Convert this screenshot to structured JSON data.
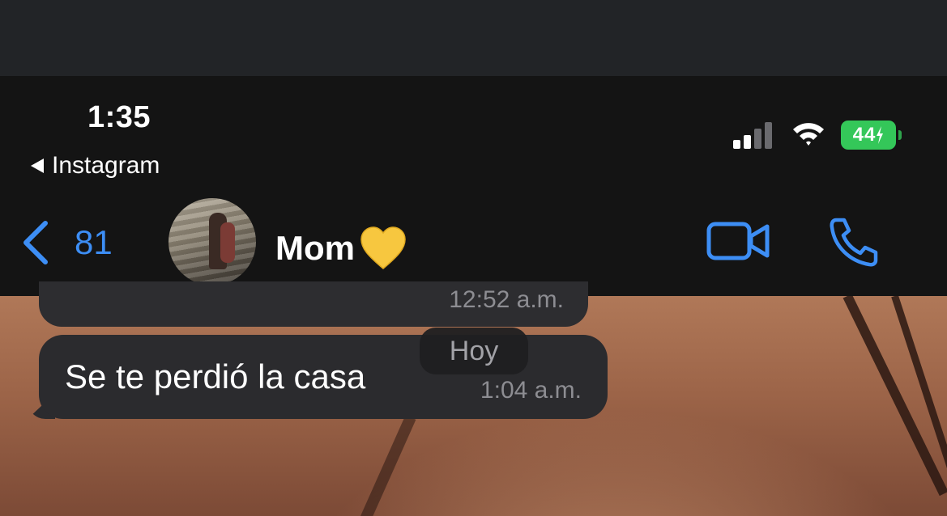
{
  "status_bar": {
    "time": "1:35",
    "back_app": "Instagram",
    "battery_level": "44",
    "battery_color": "#34c759"
  },
  "nav": {
    "unread_count": "81",
    "contact_name": "Mom",
    "contact_emoji": "💛",
    "accent_color": "#3d8ef5",
    "icons": [
      "chevron-left-icon",
      "video-camera-icon",
      "phone-icon"
    ]
  },
  "chat": {
    "previous_timestamp": "12:52 a.m.",
    "day_separator": "Hoy",
    "messages": [
      {
        "text": "Se te perdió la casa",
        "time": "1:04 a.m.",
        "direction": "incoming"
      }
    ]
  }
}
